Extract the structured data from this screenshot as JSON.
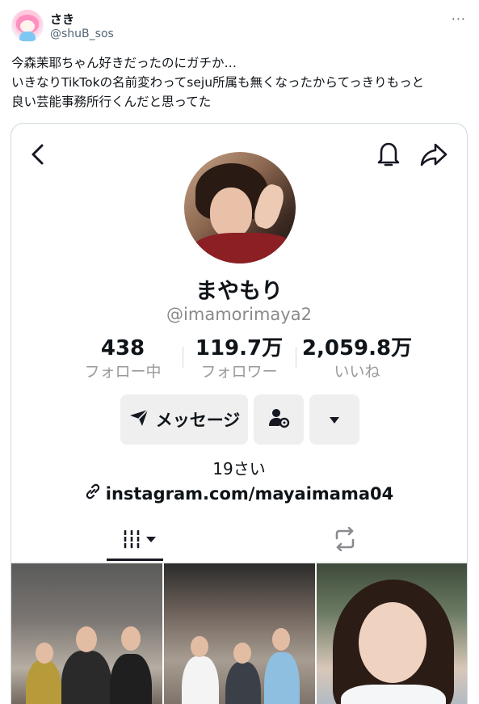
{
  "tweet": {
    "display_name": "さき",
    "handle": "@shuB_sos",
    "more_label": "···",
    "text_lines": [
      "今森茉耶ちゃん好きだったのにガチか…",
      "いきなりTikTokの名前変わってseju所属も無くなったからてっきりもっと",
      "良い芸能事務所行くんだと思ってた"
    ]
  },
  "tiktok_profile": {
    "name": "まやもり",
    "username": "@imamorimaya2",
    "stats": [
      {
        "value": "438",
        "label": "フォロー中"
      },
      {
        "value": "119.7万",
        "label": "フォロワー"
      },
      {
        "value": "2,059.8万",
        "label": "いいね"
      }
    ],
    "message_button": "メッセージ",
    "bio": "19さい",
    "link": "instagram.com/mayaimama04",
    "icons": {
      "back": "chevron-left-icon",
      "bell": "bell-icon",
      "share": "share-arrow-icon",
      "message": "paper-plane-icon",
      "add_user": "user-settings-icon",
      "dropdown": "triangle-down-icon",
      "link": "link-chain-icon",
      "videos_tab": "grid-bars-icon",
      "repost_tab": "repost-icon"
    }
  },
  "colors": {
    "secondary_text": "#536471",
    "muted_text": "#9a9a9a",
    "button_bg": "#efefef",
    "border": "#cfd9de"
  }
}
